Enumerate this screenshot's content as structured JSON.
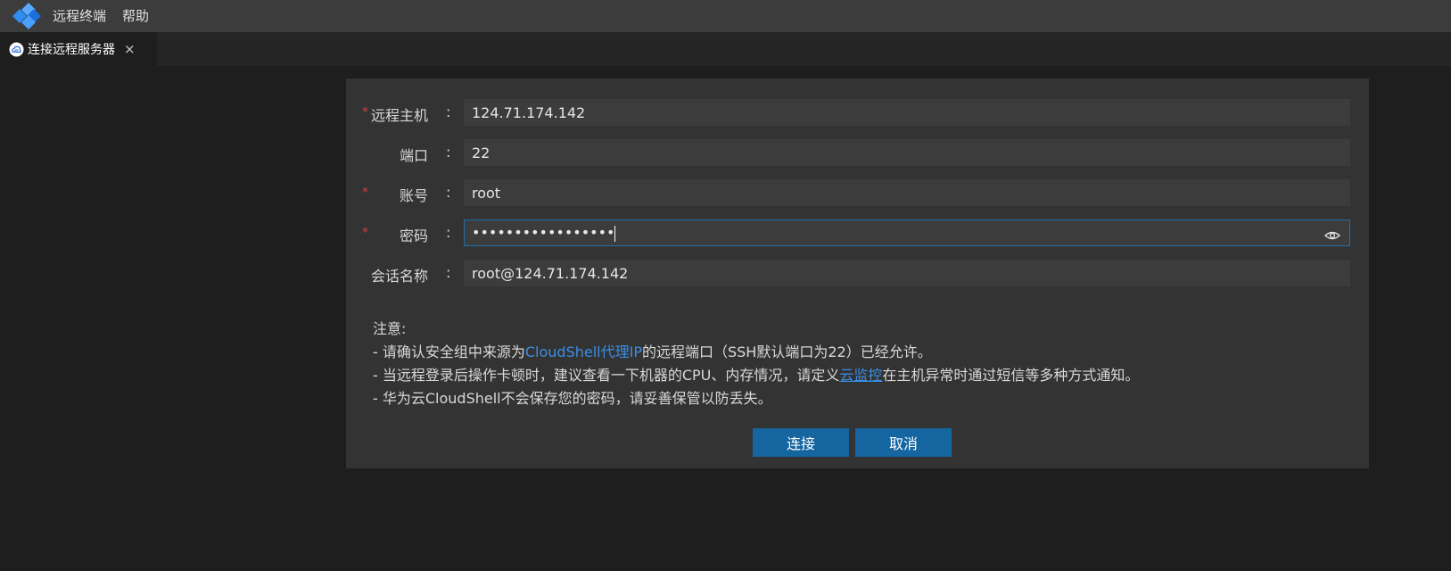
{
  "menubar": {
    "items": [
      {
        "label": "远程终端"
      },
      {
        "label": "帮助"
      }
    ]
  },
  "tab": {
    "label": "连接远程服务器",
    "close": "×"
  },
  "form": {
    "required_mark": "*",
    "colon": ":",
    "host": {
      "label": "远程主机",
      "value": "124.71.174.142",
      "required": true
    },
    "port": {
      "label": "端口",
      "value": "22",
      "required": false
    },
    "account": {
      "label": "账号",
      "value": "root",
      "required": true
    },
    "password": {
      "label": "密码",
      "value": "•••••••••••••••••",
      "required": true
    },
    "session": {
      "label": "会话名称",
      "value": "root@124.71.174.142",
      "required": false
    }
  },
  "notes": {
    "title": "注意:",
    "line1_pre": "- 请确认安全组中来源为",
    "line1_link": "CloudShell代理IP",
    "line1_post": "的远程端口（SSH默认端口为22）已经允许。",
    "line2_pre": "- 当远程登录后操作卡顿时，建议查看一下机器的CPU、内存情况，请定义",
    "line2_link": "云监控",
    "line2_post": "在主机异常时通过短信等多种方式通知。",
    "line3": "- 华为云CloudShell不会保存您的密码，请妥善保管以防丢失。"
  },
  "buttons": {
    "connect": "连接",
    "cancel": "取消"
  },
  "colors": {
    "accent": "#1565a0",
    "link": "#3a8ee6",
    "required": "#e53935"
  }
}
